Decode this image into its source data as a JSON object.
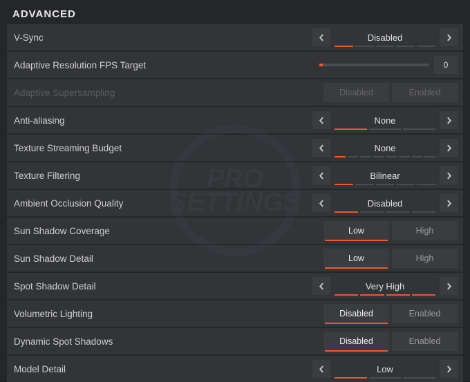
{
  "header": "ADVANCED",
  "accent": "#e85a2a",
  "rows": [
    {
      "type": "selector",
      "label": "V-Sync",
      "value": "Disabled",
      "tick_on": 1,
      "tick_count": 5
    },
    {
      "type": "slider",
      "label": "Adaptive Resolution FPS Target",
      "value": "0"
    },
    {
      "type": "toggle",
      "label": "Adaptive Supersampling",
      "options": [
        "Disabled",
        "Enabled"
      ],
      "active": null,
      "disabled": true
    },
    {
      "type": "selector",
      "label": "Anti-aliasing",
      "value": "None",
      "tick_on": 1,
      "tick_count": 3
    },
    {
      "type": "selector",
      "label": "Texture Streaming Budget",
      "value": "None",
      "tick_on": 1,
      "tick_count": 8
    },
    {
      "type": "selector",
      "label": "Texture Filtering",
      "value": "Bilinear",
      "tick_on": 1,
      "tick_count": 5
    },
    {
      "type": "selector",
      "label": "Ambient Occlusion Quality",
      "value": "Disabled",
      "tick_on": 1,
      "tick_count": 4
    },
    {
      "type": "toggle",
      "label": "Sun Shadow Coverage",
      "options": [
        "Low",
        "High"
      ],
      "active": 0
    },
    {
      "type": "toggle",
      "label": "Sun Shadow Detail",
      "options": [
        "Low",
        "High"
      ],
      "active": 0
    },
    {
      "type": "selector",
      "label": "Spot Shadow Detail",
      "value": "Very High",
      "tick_on": 4,
      "tick_count": 4
    },
    {
      "type": "toggle",
      "label": "Volumetric Lighting",
      "options": [
        "Disabled",
        "Enabled"
      ],
      "active": 0
    },
    {
      "type": "toggle",
      "label": "Dynamic Spot Shadows",
      "options": [
        "Disabled",
        "Enabled"
      ],
      "active": 0
    },
    {
      "type": "selector",
      "label": "Model Detail",
      "value": "Low",
      "tick_on": 1,
      "tick_count": 3
    }
  ]
}
